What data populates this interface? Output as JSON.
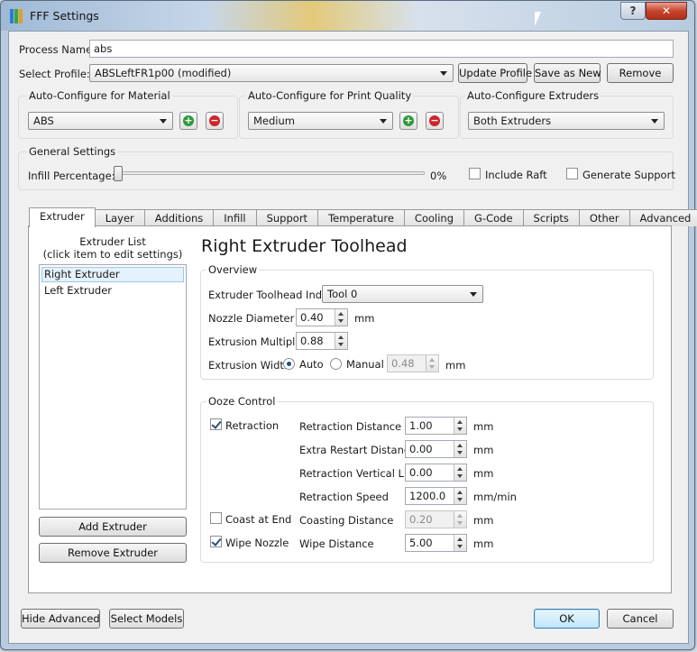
{
  "window": {
    "title": "FFF Settings",
    "help_glyph": "?",
    "close_glyph": "✕"
  },
  "process": {
    "label": "Process Name:",
    "value": "abs"
  },
  "profile": {
    "label": "Select Profile:",
    "selected": "ABSLeftFR1p00 (modified)",
    "update_label": "Update Profile",
    "save_label": "Save as New",
    "remove_label": "Remove"
  },
  "material": {
    "title": "Auto-Configure for Material",
    "selected": "ABS"
  },
  "quality": {
    "title": "Auto-Configure for Print Quality",
    "selected": "Medium"
  },
  "extruders_cfg": {
    "title": "Auto-Configure Extruders",
    "selected": "Both Extruders"
  },
  "general": {
    "title": "General Settings",
    "infill_label": "Infill Percentage:",
    "infill_value": "0%",
    "infill_fraction": 0,
    "raft_label": "Include Raft",
    "raft_checked": false,
    "support_label": "Generate Support",
    "support_checked": false
  },
  "tabs": [
    "Extruder",
    "Layer",
    "Additions",
    "Infill",
    "Support",
    "Temperature",
    "Cooling",
    "G-Code",
    "Scripts",
    "Other",
    "Advanced"
  ],
  "extruder_list": {
    "title_line1": "Extruder List",
    "title_line2": "(click item to edit settings)",
    "items": [
      "Right Extruder",
      "Left Extruder"
    ],
    "add_label": "Add Extruder",
    "remove_label": "Remove Extruder"
  },
  "toolhead": {
    "heading": "Right Extruder Toolhead",
    "overview_title": "Overview",
    "index_label": "Extruder Toolhead Index",
    "index_value": "Tool 0",
    "nozzle_label": "Nozzle Diameter",
    "nozzle_value": "0.40",
    "nozzle_unit": "mm",
    "multiplier_label": "Extrusion Multiplier",
    "multiplier_value": "0.88",
    "width_label": "Extrusion Width",
    "auto_label": "Auto",
    "manual_label": "Manual",
    "width_value": "0.48",
    "width_unit": "mm"
  },
  "ooze": {
    "title": "Ooze Control",
    "retraction_label": "Retraction",
    "retraction_checked": true,
    "coast_label": "Coast at End",
    "coast_checked": false,
    "wipe_label": "Wipe Nozzle",
    "wipe_checked": true,
    "rows": [
      {
        "label": "Retraction Distance",
        "value": "1.00",
        "unit": "mm"
      },
      {
        "label": "Extra Restart Distance",
        "value": "0.00",
        "unit": "mm"
      },
      {
        "label": "Retraction Vertical Lift",
        "value": "0.00",
        "unit": "mm"
      },
      {
        "label": "Retraction Speed",
        "value": "1200.0",
        "unit": "mm/min"
      },
      {
        "label": "Coasting Distance",
        "value": "0.20",
        "unit": "mm"
      },
      {
        "label": "Wipe Distance",
        "value": "5.00",
        "unit": "mm"
      }
    ]
  },
  "footer": {
    "hide_label": "Hide Advanced",
    "models_label": "Select Models",
    "ok_label": "OK",
    "cancel_label": "Cancel"
  },
  "colors": {
    "add": "#2e9a3a",
    "remove": "#d0242a",
    "accent": "#3c7fb1"
  },
  "icons": {
    "add": "plus-icon",
    "remove": "minus-icon"
  }
}
